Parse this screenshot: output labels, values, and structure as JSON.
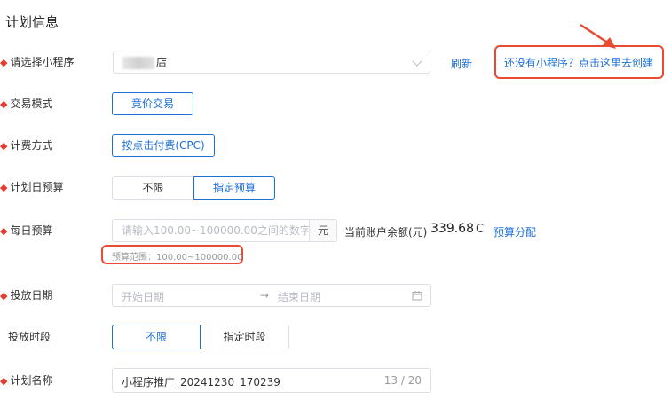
{
  "section_title": "计划信息",
  "mini_program": {
    "label": "请选择小程序",
    "value_suffix": "店",
    "refresh": "刷新",
    "create_link": "还没有小程序？点击这里去创建"
  },
  "trade_mode": {
    "label": "交易模式",
    "button": "竞价交易"
  },
  "billing": {
    "label": "计费方式",
    "button": "按点击付费(CPC)"
  },
  "daily_budget_plan": {
    "label": "计划日预算",
    "options": [
      "不限",
      "指定预算"
    ],
    "selected": "指定预算"
  },
  "daily_budget": {
    "label": "每日预算",
    "placeholder": "请输入100.00~100000.00之间的数字",
    "unit": "元",
    "balance_label": "当前账户余额(元)",
    "balance_value": "339.68",
    "refresh_glyph": "C",
    "allocate": "预算分配",
    "range_hint": "预算范围：100.00~100000.00"
  },
  "date": {
    "label": "投放日期",
    "start_placeholder": "开始日期",
    "arrow": "→",
    "end_placeholder": "结束日期"
  },
  "time_slot": {
    "label": "投放时段",
    "options": [
      "不限",
      "指定时段"
    ],
    "selected": "不限"
  },
  "plan_name": {
    "label": "计划名称",
    "value": "小程序推广_20241230_170239",
    "count": "13 / 20"
  },
  "colors": {
    "accent": "#1c6fd6",
    "required": "#e43c2e",
    "highlight": "#e84b32"
  },
  "icons": {
    "dropdown": "chevron-down-icon",
    "calendar": "calendar-icon",
    "refresh": "refresh-icon",
    "annotation": "red-arrow-icon"
  }
}
